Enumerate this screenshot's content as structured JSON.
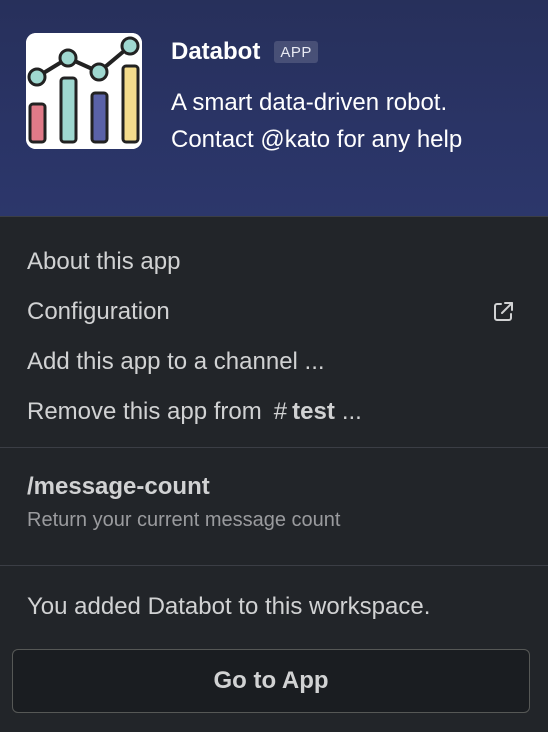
{
  "app": {
    "name": "Databot",
    "badge": "APP",
    "description": "A smart data-driven robot. Contact @kato for any help",
    "icon": "bar-line-chart-icon"
  },
  "menu": {
    "about": "About this app",
    "configuration": "Configuration",
    "add_to_channel": "Add this app to a channel ...",
    "remove_prefix": "Remove this app from",
    "remove_channel_hash": "#",
    "remove_channel_name": "test",
    "remove_suffix": "...",
    "external_icon": "external-link-icon"
  },
  "command": {
    "name": "/message-count",
    "description": "Return your current message count"
  },
  "footer": {
    "note": "You added Databot to this workspace.",
    "button_label": "Go to App"
  },
  "colors": {
    "header_bg": "#2a3466",
    "panel_bg": "#222529",
    "text": "#d1d2d3",
    "muted": "#9a9b9e"
  }
}
